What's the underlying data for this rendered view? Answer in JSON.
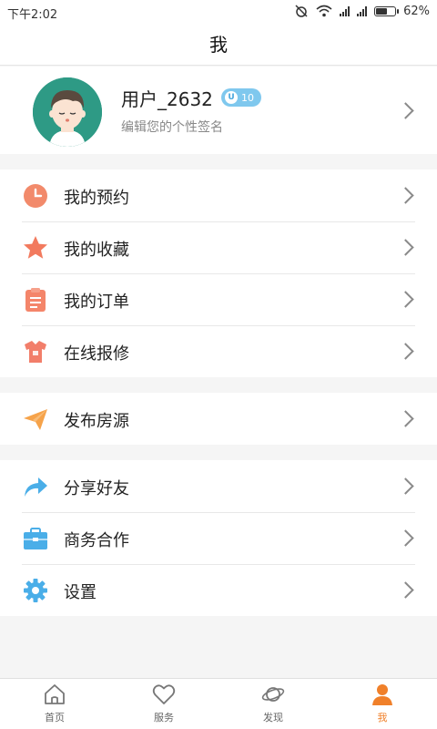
{
  "status_bar": {
    "time": "下午2:02",
    "battery": "62%",
    "battery_level": 0.62
  },
  "header": {
    "title": "我"
  },
  "profile": {
    "username": "用户_2632",
    "badge_level": "10",
    "badge_icon_letter": "U",
    "signature": "编辑您的个性签名"
  },
  "menu": {
    "appointments": "我的预约",
    "favorites": "我的收藏",
    "orders": "我的订单",
    "repair": "在线报修",
    "publish": "发布房源",
    "share": "分享好友",
    "business": "商务合作",
    "settings": "设置"
  },
  "tabs": {
    "home": "首页",
    "service": "服务",
    "discover": "发现",
    "me": "我"
  },
  "colors": {
    "accent": "#f0802a",
    "clock_icon": "#f28a6b",
    "star_icon": "#f27a5e",
    "order_icon": "#f4856a",
    "repair_icon": "#f27e6a",
    "publish_icon": "#f6a34a",
    "share_icon": "#4aaee8",
    "business_icon": "#4aaee8",
    "settings_icon": "#4aaee8",
    "badge": "#7fc8ee"
  }
}
